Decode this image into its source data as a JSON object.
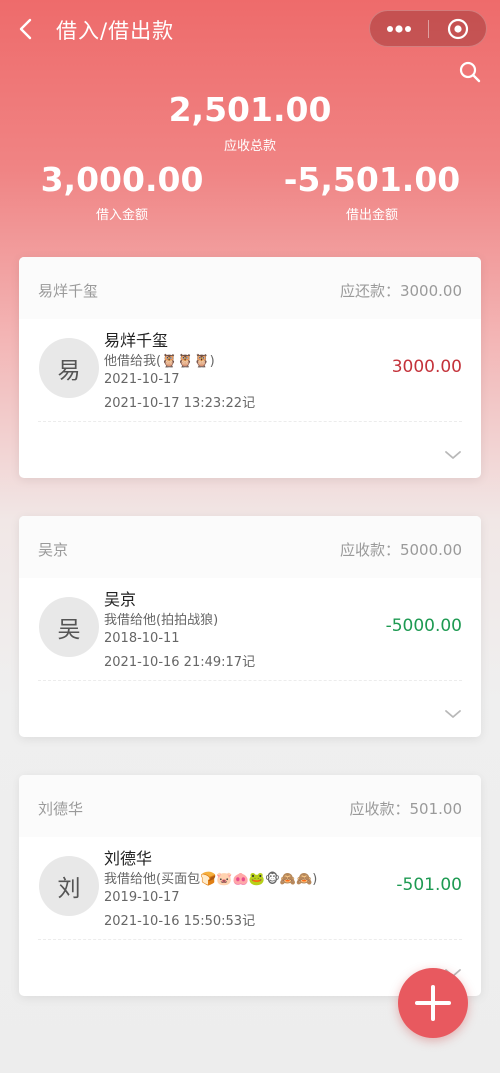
{
  "header": {
    "title": "借入/借出款",
    "back_icon": "chevron-left-icon",
    "more_icon": "more-dots-icon",
    "close_icon": "target-close-icon",
    "search_icon": "search-icon"
  },
  "summary": {
    "total_value": "2,501.00",
    "total_label": "应收总款",
    "borrowed_value": "3,000.00",
    "borrowed_label": "借入金额",
    "lent_value": "-5,501.00",
    "lent_label": "借出金额"
  },
  "records": [
    {
      "header_name": "易烊千玺",
      "due_text": "应还款：3000.00",
      "avatar_char": "易",
      "name": "易烊千玺",
      "note": "他借给我(🦉🦉🦉)",
      "date": "2021-10-17",
      "recorded": "2021-10-17 13:23:22记",
      "amount": "3000.00",
      "amount_color": "#c4333b"
    },
    {
      "header_name": "吴京",
      "due_text": "应收款：5000.00",
      "avatar_char": "吴",
      "name": "吴京",
      "note": "我借给他(拍拍战狼)",
      "date": "2018-10-11",
      "recorded": "2021-10-16 21:49:17记",
      "amount": "-5000.00",
      "amount_color": "#1e9a52"
    },
    {
      "header_name": "刘德华",
      "due_text": "应收款：501.00",
      "avatar_char": "刘",
      "name": "刘德华",
      "note": "我借给他(买面包🍞🐷🐽🐸🐵🙈🙈)",
      "date": "2019-10-17",
      "recorded": "2021-10-16 15:50:53记",
      "amount": "-501.00",
      "amount_color": "#1e9a52"
    }
  ],
  "fab": {
    "icon": "plus-icon"
  },
  "colors": {
    "header_red": "#ee6b6b",
    "fab_red": "#e8595f",
    "debt_red": "#c4333b",
    "credit_green": "#1e9a52"
  }
}
